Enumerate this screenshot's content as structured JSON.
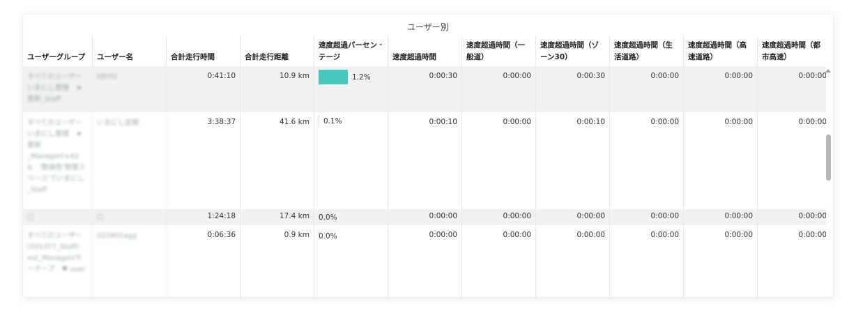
{
  "report": {
    "title": "ユーザー別",
    "columns": [
      {
        "label": "ユーザーグループ"
      },
      {
        "label": "ユーザー名"
      },
      {
        "label": "合計走行時間"
      },
      {
        "label": "合計走行距離"
      },
      {
        "label": "速度超過パーセンテージ",
        "sort_icon": "chevron-down-icon",
        "sort_glyph": "⌄"
      },
      {
        "label": "速度超過時間"
      },
      {
        "label": "速度超過時間（一般道）"
      },
      {
        "label": "速度超過時間（ゾーン30）"
      },
      {
        "label": "速度超過時間（生活道路）"
      },
      {
        "label": "速度超過時間（高速道路）"
      },
      {
        "label": "速度超過時間（都市高速）"
      }
    ],
    "rows": [
      {
        "group": "すべてのユーザー　いまにし管理　★更新_Staff",
        "user": "KEIYO",
        "drive_time": "0:41:10",
        "distance": "10.9 km",
        "speeding_pct": "1.2%",
        "speeding_pct_value": 1.2,
        "speeding_time": "0:00:30",
        "general_road": "0:00:00",
        "zone30": "0:00:30",
        "residential": "0:00:00",
        "expressway": "0:00:00",
        "urban_expressway": "0:00:00"
      },
      {
        "group": "すべてのユーザー　いまにし管理　★更新　_Manager(×A2 &　'数値性'管理スペース'でいまにし　_Staff",
        "user": "いまにし定期",
        "drive_time": "3:38:37",
        "distance": "41.6 km",
        "speeding_pct": "0.1%",
        "speeding_pct_value": 0.1,
        "speeding_time": "0:00:10",
        "general_road": "0:00:00",
        "zone30": "0:00:10",
        "residential": "0:00:00",
        "expressway": "0:00:00",
        "urban_expressway": "0:00:00"
      },
      {
        "group": "□",
        "user": "□",
        "drive_time": "1:24:18",
        "distance": "17.4 km",
        "speeding_pct": "0.0%",
        "speeding_pct_value": 0.0,
        "speeding_time": "0:00:00",
        "general_road": "0:00:00",
        "zone30": "0:00:00",
        "residential": "0:00:00",
        "expressway": "0:00:00",
        "urban_expressway": "0:00:00"
      },
      {
        "group": "すべてのユーザー　(2013T7_Staff)　ext_Manager(サーグープ　♥ user",
        "user": "022801agg",
        "drive_time": "0:06:36",
        "distance": "0.9 km",
        "speeding_pct": "0.0%",
        "speeding_pct_value": 0.0,
        "speeding_time": "0:00:00",
        "general_road": "0:00:00",
        "zone30": "0:00:00",
        "residential": "0:00:00",
        "expressway": "0:00:00",
        "urban_expressway": "0:00:00"
      }
    ]
  },
  "colors": {
    "bar": "#45c8be",
    "alt_row": "#f1f1f1"
  }
}
